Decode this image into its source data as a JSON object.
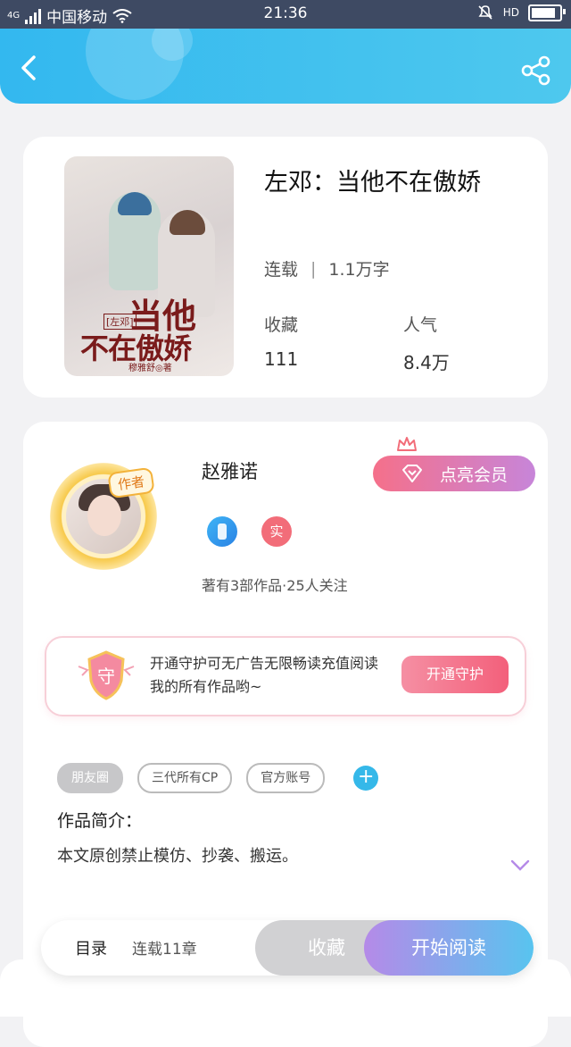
{
  "status_bar": {
    "network": "4G",
    "carrier": "中国移动",
    "time": "21:36",
    "hd_label": "HD"
  },
  "header": {
    "back_icon": "chevron-left-icon",
    "share_icon": "share-icon",
    "color_start": "#33b8ef",
    "color_end": "#4ec8ee"
  },
  "book": {
    "cover_title_line1": "当他",
    "cover_title_line2": "不在傲娇",
    "cover_tag": "[左邓]",
    "cover_author": "穆雅舒◎著",
    "title": "左邓：当他不在傲娇",
    "status": "连载",
    "word_count": "1.1万字",
    "favorites_label": "收藏",
    "favorites_value": "111",
    "popularity_label": "人气",
    "popularity_value": "8.4万"
  },
  "author": {
    "tag": "作者",
    "name": "赵雅诺",
    "vip_button": "点亮会员",
    "badge_red_text": "实",
    "stats": "著有3部作品·25人关注"
  },
  "guard": {
    "icon_text": "守",
    "text": "开通守护可无广告无限畅读充值阅读我的所有作品哟~",
    "button": "开通守护"
  },
  "tags": [
    "朋友圈",
    "三代所有CP",
    "官方账号"
  ],
  "intro": {
    "title": "作品简介：",
    "text": "本文原创禁止模仿、抄袭、搬运。"
  },
  "bottom_bar": {
    "toc": "目录",
    "chapter_info": "连载11章",
    "favorite_button": "收藏",
    "read_button": "开始阅读"
  },
  "colors": {
    "accent_blue": "#35b8e9",
    "vip_pink": "#f5708a",
    "read_gradient_start": "#b58ae8",
    "read_gradient_end": "#58c4ef"
  }
}
